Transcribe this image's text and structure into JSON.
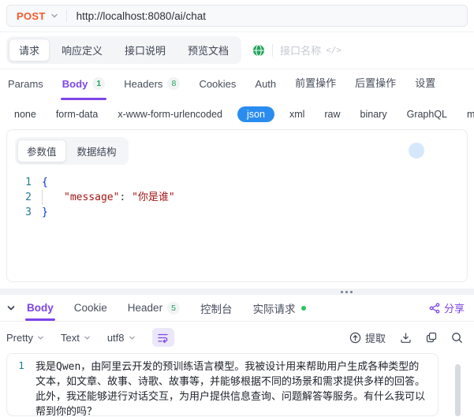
{
  "request_bar": {
    "method": "POST",
    "url": "http://localhost:8080/ai/chat"
  },
  "doc_tabs": {
    "items": [
      "请求",
      "响应定义",
      "接口说明",
      "预览文档"
    ],
    "active": "请求",
    "api_name_placeholder": "接口名称",
    "code_icon_glyph": "</>"
  },
  "request_tabs": {
    "active": "Body",
    "items": [
      {
        "label": "Params",
        "badge": ""
      },
      {
        "label": "Body",
        "badge": "1"
      },
      {
        "label": "Headers",
        "badge": "8"
      },
      {
        "label": "Cookies",
        "badge": ""
      },
      {
        "label": "Auth",
        "badge": ""
      },
      {
        "label": "前置操作",
        "badge": ""
      },
      {
        "label": "后置操作",
        "badge": ""
      },
      {
        "label": "设置",
        "badge": ""
      }
    ]
  },
  "body_types": {
    "active": "json",
    "items": [
      "none",
      "form-data",
      "x-www-form-urlencoded",
      "json",
      "xml",
      "raw",
      "binary",
      "GraphQL",
      "msgpack"
    ]
  },
  "editor": {
    "tabs": [
      "参数值",
      "数据结构"
    ],
    "active_tab": "参数值",
    "line_numbers": [
      "1",
      "2",
      "3"
    ],
    "code": {
      "open_brace": "{",
      "key": "\"message\"",
      "colon": ": ",
      "value": "\"你是谁\"",
      "close_brace": "}"
    }
  },
  "response": {
    "tabs": [
      {
        "label": "Body",
        "badge": ""
      },
      {
        "label": "Cookie",
        "badge": ""
      },
      {
        "label": "Header",
        "badge": "5"
      },
      {
        "label": "控制台",
        "badge": ""
      },
      {
        "label": "实际请求",
        "badge": ""
      }
    ],
    "active_tab": "Body",
    "share_label": "分享",
    "toolbar": {
      "format_mode": "Pretty",
      "view_mode": "Text",
      "encoding": "utf8",
      "extract_label": "提取"
    },
    "body": {
      "line_number": "1",
      "text": "我是Qwen，由阿里云开发的预训练语言模型。我被设计用来帮助用户生成各种类型的文本，如文章、故事、诗歌、故事等，并能够根据不同的场景和需求提供多样的回答。此外，我还能够进行对话交互，为用户提供信息查询、问题解答等服务。有什么我可以帮到你的吗？"
    }
  },
  "colors": {
    "accent_purple": "#7c45e8",
    "json_pill_blue": "#2b8cf0",
    "method_orange": "#f25a29",
    "badge_green": "#22a35c",
    "live_dot_green": "#2fc25b",
    "string_red": "#a31515",
    "brace_blue": "#0433d9",
    "line_number_blue": "#237893"
  }
}
